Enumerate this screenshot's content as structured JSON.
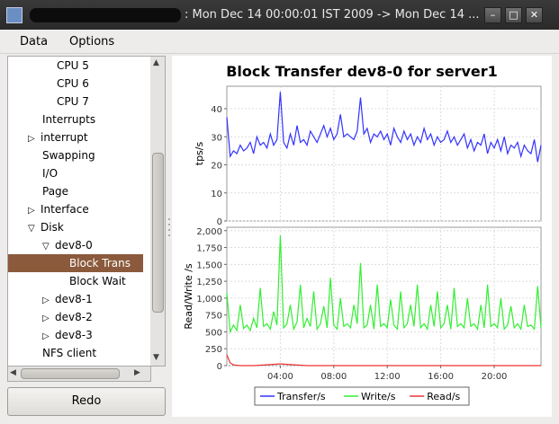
{
  "titlebar": {
    "title": ": Mon Dec 14 00:00:01 IST 2009 -> Mon Dec 14 ...",
    "minimize": "–",
    "maximize": "□",
    "close": "✕"
  },
  "menubar": {
    "items": [
      "Data",
      "Options"
    ]
  },
  "tree": {
    "items": [
      {
        "label": "CPU 5",
        "toggle": ""
      },
      {
        "label": "CPU 6",
        "toggle": ""
      },
      {
        "label": "CPU 7",
        "toggle": ""
      },
      {
        "label": "Interrupts",
        "toggle": ""
      },
      {
        "label": "interrupt",
        "toggle": "▷"
      },
      {
        "label": "Swapping",
        "toggle": ""
      },
      {
        "label": "I/O",
        "toggle": ""
      },
      {
        "label": "Page",
        "toggle": ""
      },
      {
        "label": "Interface",
        "toggle": "▷"
      },
      {
        "label": "Disk",
        "toggle": "▽"
      },
      {
        "label": "dev8-0",
        "toggle": "▽"
      },
      {
        "label": "Block Trans",
        "toggle": "",
        "selected": true
      },
      {
        "label": "Block Wait",
        "toggle": ""
      },
      {
        "label": "dev8-1",
        "toggle": "▷"
      },
      {
        "label": "dev8-2",
        "toggle": "▷"
      },
      {
        "label": "dev8-3",
        "toggle": "▷"
      },
      {
        "label": "NFS client",
        "toggle": ""
      }
    ]
  },
  "redo_label": "Redo",
  "colors": {
    "transfer": "#3333ff",
    "write": "#33ee33",
    "read": "#ee3333",
    "selection": "#8b5a3c"
  },
  "chart_data": {
    "type": "line",
    "title": "Block Transfer dev8-0 for server1",
    "x_ticks": [
      "04:00",
      "08:00",
      "12:00",
      "16:00",
      "20:00"
    ],
    "x_tick_hours": [
      4,
      8,
      12,
      16,
      20
    ],
    "x_range_hours": [
      0,
      23.5
    ],
    "grid": true,
    "legend_position": "bottom",
    "panels": [
      {
        "ylabel": "tps/s",
        "ylim": [
          0,
          48
        ],
        "y_ticks": [
          0,
          10,
          20,
          30,
          40
        ],
        "series": [
          {
            "name": "Transfer/s",
            "color": "#3333ff",
            "hours": [
              0,
              0.25,
              0.5,
              0.75,
              1,
              1.25,
              1.5,
              1.75,
              2,
              2.25,
              2.5,
              2.75,
              3,
              3.25,
              3.5,
              3.75,
              4,
              4.25,
              4.5,
              4.75,
              5,
              5.25,
              5.5,
              5.75,
              6,
              6.25,
              6.5,
              6.75,
              7,
              7.25,
              7.5,
              7.75,
              8,
              8.25,
              8.5,
              8.75,
              9,
              9.25,
              9.5,
              9.75,
              10,
              10.25,
              10.5,
              10.75,
              11,
              11.25,
              11.5,
              11.75,
              12,
              12.25,
              12.5,
              12.75,
              13,
              13.25,
              13.5,
              13.75,
              14,
              14.25,
              14.5,
              14.75,
              15,
              15.25,
              15.5,
              15.75,
              16,
              16.25,
              16.5,
              16.75,
              17,
              17.25,
              17.5,
              17.75,
              18,
              18.25,
              18.5,
              18.75,
              19,
              19.25,
              19.5,
              19.75,
              20,
              20.25,
              20.5,
              20.75,
              21,
              21.25,
              21.5,
              21.75,
              22,
              22.25,
              22.5,
              22.75,
              23,
              23.25,
              23.5
            ],
            "values": [
              37,
              23,
              25,
              24,
              27,
              25,
              26,
              28,
              24,
              30,
              27,
              28,
              26,
              31,
              27,
              29,
              46,
              28,
              26,
              31,
              27,
              34,
              28,
              29,
              27,
              32,
              30,
              28,
              31,
              34,
              30,
              33,
              29,
              31,
              38,
              30,
              31,
              30,
              29,
              32,
              44,
              31,
              33,
              28,
              31,
              30,
              32,
              29,
              31,
              27,
              33,
              30,
              28,
              32,
              29,
              31,
              27,
              30,
              28,
              33,
              29,
              31,
              27,
              30,
              28,
              29,
              32,
              28,
              30,
              27,
              29,
              31,
              26,
              29,
              25,
              28,
              27,
              31,
              24,
              28,
              26,
              29,
              25,
              30,
              24,
              27,
              26,
              28,
              23,
              27,
              25,
              24,
              29,
              21,
              27,
              24,
              29
            ]
          }
        ]
      },
      {
        "ylabel": "Read/Write /s",
        "ylim": [
          0,
          2050
        ],
        "y_ticks": [
          0,
          250,
          500,
          750,
          1000,
          1250,
          1500,
          1750,
          2000
        ],
        "y_tick_labels": [
          "0",
          "250",
          "500",
          "750",
          "1,000",
          "1,250",
          "1,500",
          "1,750",
          "2,000"
        ],
        "series": [
          {
            "name": "Write/s",
            "color": "#33ee33",
            "hours": [
              0,
              0.25,
              0.5,
              0.75,
              1,
              1.25,
              1.5,
              1.75,
              2,
              2.25,
              2.5,
              2.75,
              3,
              3.25,
              3.5,
              3.75,
              4,
              4.25,
              4.5,
              4.75,
              5,
              5.25,
              5.5,
              5.75,
              6,
              6.25,
              6.5,
              6.75,
              7,
              7.25,
              7.5,
              7.75,
              8,
              8.25,
              8.5,
              8.75,
              9,
              9.25,
              9.5,
              9.75,
              10,
              10.25,
              10.5,
              10.75,
              11,
              11.25,
              11.5,
              11.75,
              12,
              12.25,
              12.5,
              12.75,
              13,
              13.25,
              13.5,
              13.75,
              14,
              14.25,
              14.5,
              14.75,
              15,
              15.25,
              15.5,
              15.75,
              16,
              16.25,
              16.5,
              16.75,
              17,
              17.25,
              17.5,
              17.75,
              18,
              18.25,
              18.5,
              18.75,
              19,
              19.25,
              19.5,
              19.75,
              20,
              20.25,
              20.5,
              20.75,
              21,
              21.25,
              21.5,
              21.75,
              22,
              22.25,
              22.5,
              22.75,
              23,
              23.25,
              23.5
            ],
            "values": [
              1080,
              500,
              600,
              520,
              900,
              550,
              600,
              520,
              700,
              560,
              1150,
              580,
              620,
              540,
              800,
              600,
              1930,
              560,
              620,
              900,
              540,
              650,
              1200,
              560,
              700,
              580,
              1100,
              540,
              620,
              880,
              560,
              1300,
              600,
              540,
              1000,
              580,
              620,
              560,
              900,
              620,
              1520,
              560,
              600,
              900,
              540,
              1200,
              580,
              620,
              560,
              980,
              600,
              540,
              1100,
              560,
              620,
              900,
              580,
              1200,
              560,
              620,
              540,
              900,
              580,
              1100,
              560,
              620,
              900,
              540,
              1150,
              580,
              620,
              560,
              1000,
              580,
              620,
              540,
              900,
              560,
              1200,
              580,
              620,
              560,
              1000,
              540,
              600,
              880,
              560,
              620,
              540,
              900,
              580,
              600,
              540,
              1180,
              560,
              620,
              580
            ]
          },
          {
            "name": "Read/s",
            "color": "#ee3333",
            "hours": [
              0,
              0.25,
              0.5,
              0.75,
              1,
              2,
              4,
              6,
              8,
              10,
              12,
              14,
              16,
              18,
              20,
              22,
              23.5
            ],
            "values": [
              160,
              40,
              10,
              5,
              0,
              0,
              25,
              0,
              0,
              0,
              0,
              0,
              0,
              0,
              0,
              0,
              0
            ]
          }
        ]
      }
    ]
  }
}
